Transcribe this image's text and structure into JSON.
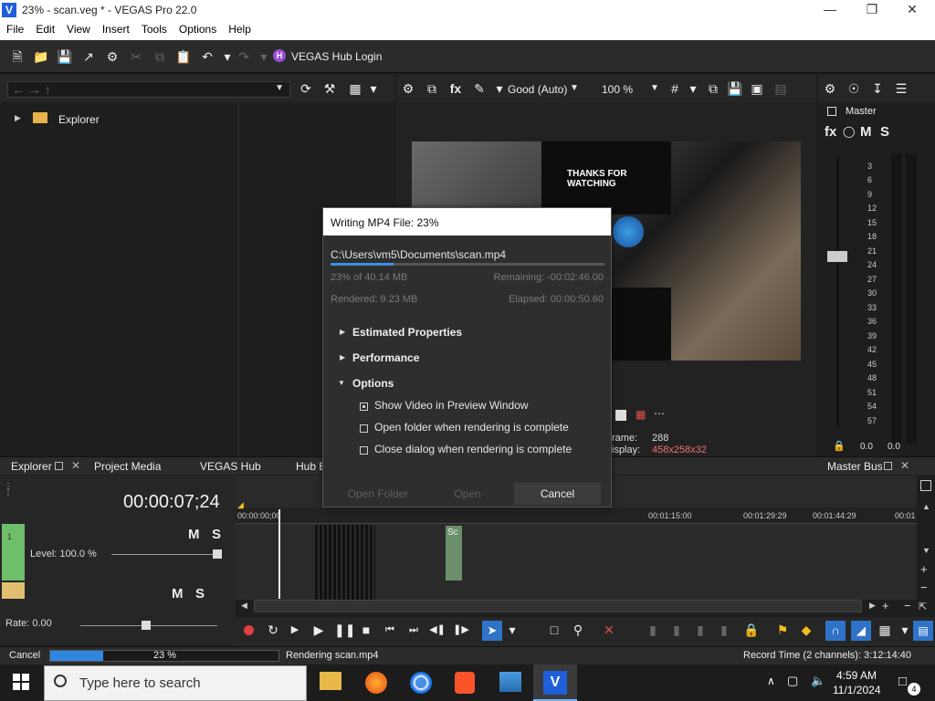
{
  "window": {
    "title": "23% - scan.veg * - VEGAS Pro 22.0",
    "logo": "V"
  },
  "menu": [
    "File",
    "Edit",
    "View",
    "Insert",
    "Tools",
    "Options",
    "Help"
  ],
  "toolbar": {
    "hub_badge": "H",
    "hub_label": "VEGAS Hub Login"
  },
  "explorer": {
    "tree_item": "Explorer"
  },
  "preview": {
    "quality": "Good (Auto)",
    "zoom": "100 %",
    "frame_label": "rame:",
    "frame_value": "288",
    "display_label": "isplay:",
    "display_value": "458x258x32"
  },
  "master": {
    "label": "Master",
    "fx": "fx",
    "m": "M",
    "s": "S",
    "meter_ticks": [
      "3",
      "6",
      "9",
      "12",
      "15",
      "18",
      "21",
      "24",
      "27",
      "30",
      "33",
      "36",
      "39",
      "42",
      "45",
      "48",
      "51",
      "54",
      "57"
    ],
    "left_val": "0.0",
    "right_val": "0.0"
  },
  "tabs": {
    "explorer": "Explorer",
    "project_media": "Project Media",
    "vegas_hub": "VEGAS Hub",
    "hub_e": "Hub E",
    "master_bus": "Master Bus"
  },
  "timeline": {
    "timecode": "00:00:07;24",
    "level": "Level: 100.0 %",
    "rate": "Rate: 0.00",
    "m": "M",
    "s": "S",
    "ruler": [
      "00:00:00;00",
      "00:01:15:00",
      "00:01:29:29",
      "00:01:44:29",
      "00:01"
    ],
    "clip_label": "Sc"
  },
  "dialog": {
    "title": "Writing MP4 File: 23%",
    "path": "C:\\Users\\vm5\\Documents\\scan.mp4",
    "progress_pct": 23,
    "of_size": "23% of 40.14 MB",
    "remaining": "Remaining: -00:02:46.00",
    "rendered": "Rendered: 9.23 MB",
    "elapsed": "Elapsed: 00:00:50.60",
    "sections": [
      "Estimated Properties",
      "Performance",
      "Options"
    ],
    "options": [
      {
        "label": "Show Video in Preview Window",
        "checked": true
      },
      {
        "label": "Open folder when rendering is complete",
        "checked": false
      },
      {
        "label": "Close dialog when rendering is complete",
        "checked": false
      }
    ],
    "buttons": {
      "open_folder": "Open Folder",
      "open": "Open",
      "cancel": "Cancel"
    }
  },
  "status": {
    "cancel": "Cancel",
    "percent": "23 %",
    "progress_pct": 23,
    "message": "Rendering scan.mp4",
    "record_time": "Record Time (2 channels): 3:12:14:40"
  },
  "taskbar": {
    "search_placeholder": "Type here to search",
    "time": "4:59 AM",
    "date": "11/1/2024",
    "notif_count": "4"
  }
}
